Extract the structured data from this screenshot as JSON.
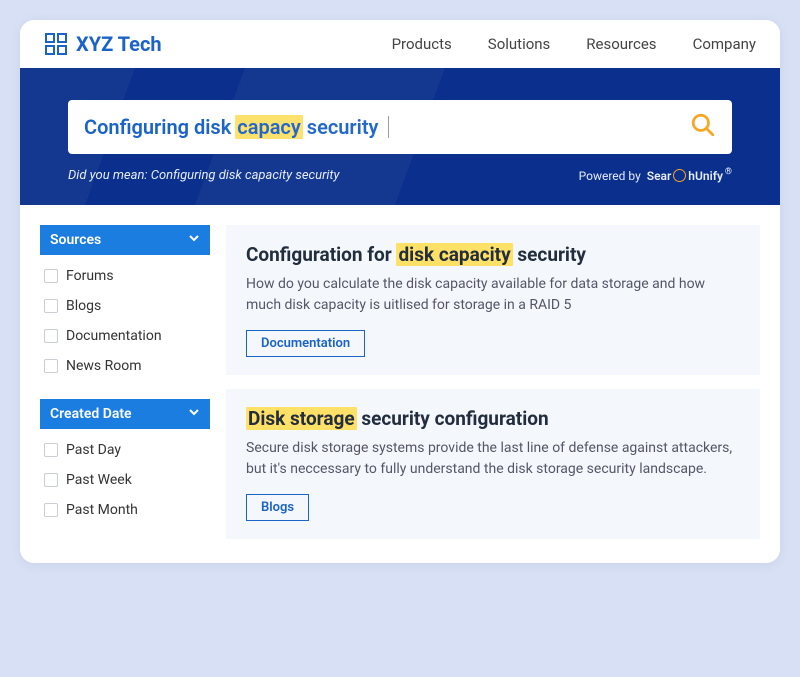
{
  "header": {
    "brand": "XYZ Tech",
    "nav": [
      "Products",
      "Solutions",
      "Resources",
      "Company"
    ]
  },
  "search": {
    "query_pre": "Configuring disk ",
    "query_hl": "capacy",
    "query_post": " security",
    "did_you_mean_label": "Did you mean: ",
    "did_you_mean_text": "Configuring disk capacity security",
    "powered_by_label": "Powered by",
    "powered_by_brand_pre": "Sear",
    "powered_by_brand_post": "hUnify"
  },
  "facets": [
    {
      "title": "Sources",
      "items": [
        "Forums",
        "Blogs",
        "Documentation",
        "News Room"
      ]
    },
    {
      "title": "Created Date",
      "items": [
        "Past Day",
        "Past Week",
        "Past Month"
      ]
    }
  ],
  "results": [
    {
      "title_pre": "Configuration for ",
      "title_hl": "disk capacity",
      "title_post": " security",
      "body": "How do you calculate the disk capacity available for data storage and how much disk capacity is uitlised for storage in a RAID 5",
      "tag": "Documentation"
    },
    {
      "title_pre": "",
      "title_hl": "Disk storage",
      "title_post": " security configuration",
      "body": "Secure disk storage systems provide the last line of defense against attackers, but it's neccessary to fully understand the disk storage security landscape.",
      "tag": "Blogs"
    }
  ]
}
